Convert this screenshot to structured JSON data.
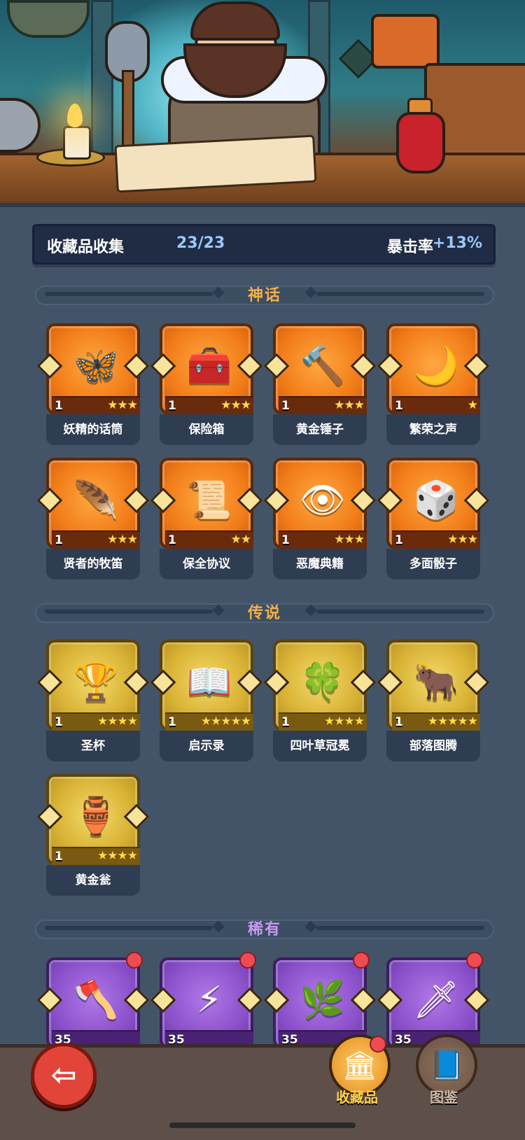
{
  "collection": {
    "label": "收藏品收集",
    "progress": "23/23",
    "stat_label": "暴击率",
    "stat_value": "+13%"
  },
  "sections": {
    "mythic": {
      "title": "神话",
      "color": "#f4b04a"
    },
    "legendary": {
      "title": "传说",
      "color": "#f4b04a"
    },
    "rare": {
      "title": "稀有",
      "color": "#c79af3"
    }
  },
  "items": {
    "mythic": [
      {
        "name": "妖精的话筒",
        "level": "1",
        "stars": "★★★",
        "icon": "fairy-microphone-icon"
      },
      {
        "name": "保险箱",
        "level": "1",
        "stars": "★★★",
        "icon": "treasure-chest-icon"
      },
      {
        "name": "黄金锤子",
        "level": "1",
        "stars": "★★★",
        "icon": "golden-hammer-icon"
      },
      {
        "name": "繁荣之声",
        "level": "1",
        "stars": "★",
        "icon": "prosperity-voice-icon"
      },
      {
        "name": "贤者的牧笛",
        "level": "1",
        "stars": "★★★",
        "icon": "sage-flute-icon"
      },
      {
        "name": "保全协议",
        "level": "1",
        "stars": "★★",
        "icon": "agreement-scroll-icon"
      },
      {
        "name": "恶魔典籍",
        "level": "1",
        "stars": "★★★",
        "icon": "demon-tome-icon"
      },
      {
        "name": "多面骰子",
        "level": "1",
        "stars": "★★★",
        "icon": "polyhedral-dice-icon"
      }
    ],
    "legendary": [
      {
        "name": "圣杯",
        "level": "1",
        "stars": "★★★★",
        "icon": "holy-grail-icon"
      },
      {
        "name": "启示录",
        "level": "1",
        "stars": "★★★★★",
        "icon": "revelation-book-icon"
      },
      {
        "name": "四叶草冠冕",
        "level": "1",
        "stars": "★★★★",
        "icon": "clover-crown-icon"
      },
      {
        "name": "部落图腾",
        "level": "1",
        "stars": "★★★★★",
        "icon": "tribal-totem-icon"
      },
      {
        "name": "黄金瓮",
        "level": "1",
        "stars": "★★★★",
        "icon": "golden-urn-icon"
      }
    ],
    "rare": [
      {
        "level": "35",
        "icon": "stone-axe-icon"
      },
      {
        "level": "35",
        "icon": "lightning-gem-icon"
      },
      {
        "level": "35",
        "icon": "thorn-knuckles-icon"
      },
      {
        "level": "35",
        "icon": "frost-dagger-icon"
      }
    ]
  },
  "nav": {
    "collection_label": "收藏品",
    "codex_label": "图鉴",
    "back_icon": "back-arrow-icon",
    "collection_icon": "collection-icon",
    "codex_icon": "book-icon"
  },
  "colors": {
    "mythic": "#f27d19",
    "legendary": "#d8b234",
    "rare": "#8c52cc",
    "accent_blue": "#9cc8ff",
    "notification": "#ee4b53"
  }
}
